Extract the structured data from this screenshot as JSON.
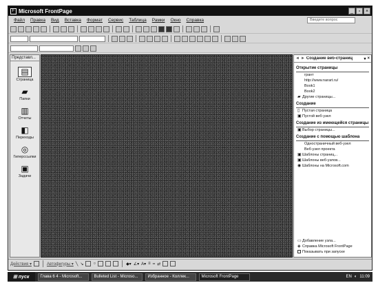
{
  "window": {
    "title": "Microsoft FrontPage",
    "controls": {
      "minimize": "_",
      "restore": "▫",
      "close": "×"
    }
  },
  "menu": {
    "items": [
      "Файл",
      "Правка",
      "Вид",
      "Вставка",
      "Формат",
      "Сервис",
      "Таблица",
      "Рамки",
      "Окно",
      "Справка"
    ],
    "help_placeholder": "Введите вопрос"
  },
  "views_bar": {
    "header": "Представл...",
    "items": [
      {
        "label": "Страница",
        "icon": "page-icon"
      },
      {
        "label": "Папки",
        "icon": "folders-icon"
      },
      {
        "label": "Отчеты",
        "icon": "reports-icon"
      },
      {
        "label": "Переходы",
        "icon": "navigation-icon"
      },
      {
        "label": "Гиперссылки",
        "icon": "hyperlinks-icon"
      },
      {
        "label": "Задачи",
        "icon": "tasks-icon"
      }
    ]
  },
  "task_pane": {
    "title": "Создание веб-страниц",
    "sections": {
      "open": {
        "heading": "Открытие страницы",
        "items": [
          "грант",
          "http://www.narart.ru/",
          "Book1",
          "Book2",
          "Другие страницы..."
        ]
      },
      "create": {
        "heading": "Создание",
        "items": [
          "Пустая страница",
          "Пустой веб-узел"
        ]
      },
      "from_existing": {
        "heading": "Создание из имеющейся страницы",
        "items": [
          "Выбор страницы..."
        ]
      },
      "from_template": {
        "heading": "Создание с помощью шаблона",
        "items": [
          "Одностраничный веб-узел",
          "Веб-узел проекта",
          "Шаблоны страниц...",
          "Шаблоны веб-узлов...",
          "Шаблоны на Microsoft.com"
        ]
      }
    },
    "bottom": {
      "add_node": "Добавление узла...",
      "help": "Справка Microsoft FrontPage",
      "show_at_startup": "Показывать при запуске"
    }
  },
  "drawing_bar": {
    "actions_label": "Действия ▾",
    "autoshapes_label": "Автофигуры ▾"
  },
  "taskbar": {
    "start_label": "пуск",
    "tasks": [
      "Глава 6 4 - Microsoft...",
      "Bulleted List - Microso...",
      "Избранное - Коллек...",
      "Microsoft FrontPage"
    ],
    "language": "EN",
    "time": "11:09"
  }
}
